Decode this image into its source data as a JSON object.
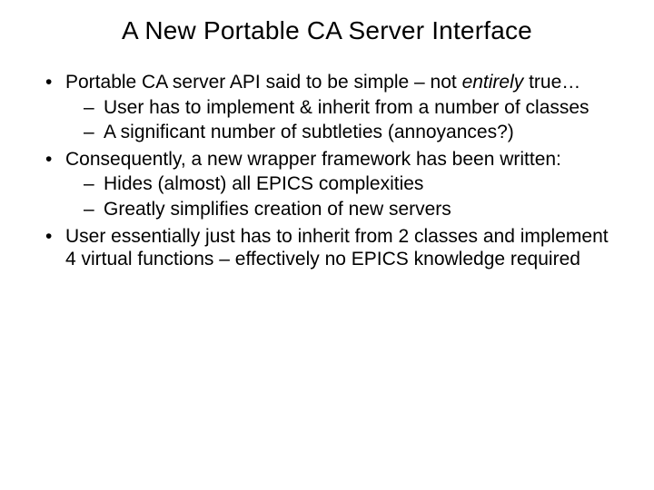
{
  "title": "A New Portable CA Server Interface",
  "bullets": {
    "b1_pre": "Portable CA server API said to be simple – not ",
    "b1_em": "entirely",
    "b1_post": " true…",
    "b1_sub1": "User has to implement & inherit from a number of classes",
    "b1_sub2": "A significant number of subtleties (annoyances?)",
    "b2": "Consequently, a new wrapper framework has been written:",
    "b2_sub1": "Hides (almost) all EPICS complexities",
    "b2_sub2": "Greatly simplifies creation of new servers",
    "b3": "User essentially just has to inherit from 2 classes and implement 4 virtual functions – effectively no EPICS knowledge required"
  }
}
